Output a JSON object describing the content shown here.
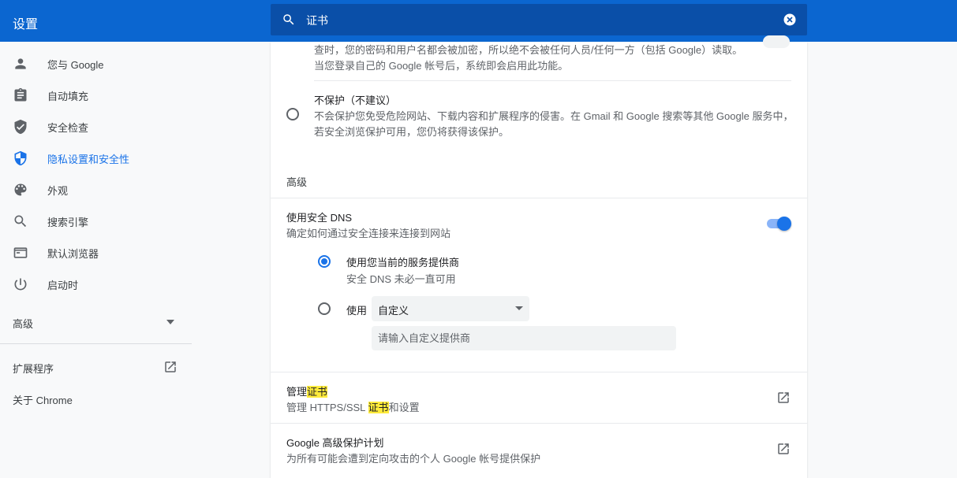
{
  "header": {
    "title": "设置",
    "search_value": "证书"
  },
  "sidebar": {
    "items": [
      {
        "label": "您与 Google",
        "icon": "person-icon"
      },
      {
        "label": "自动填充",
        "icon": "clipboard-icon"
      },
      {
        "label": "安全检查",
        "icon": "shield-check-icon"
      },
      {
        "label": "隐私设置和安全性",
        "icon": "shield-privacy-icon",
        "active": true
      },
      {
        "label": "外观",
        "icon": "palette-icon"
      },
      {
        "label": "搜索引擎",
        "icon": "search-icon"
      },
      {
        "label": "默认浏览器",
        "icon": "browser-icon"
      },
      {
        "label": "启动时",
        "icon": "power-icon"
      }
    ],
    "advanced": "高级",
    "extensions": "扩展程序",
    "about": "关于 Chrome"
  },
  "main": {
    "top_text_line1": "查时，您的密码和用户名都会被加密，所以绝不会被任何人员/任何一方（包括 Google）读取。",
    "top_text_line2": "当您登录自己的 Google 帐号后，系统即会启用此功能。",
    "no_protection": {
      "title": "不保护（不建议）",
      "desc_line1": "不会保护您免受危险网站、下载内容和扩展程序的侵害。在 Gmail 和 Google 搜索等其他 Google 服务中，",
      "desc_line2": "若安全浏览保护可用，您仍将获得该保护。"
    },
    "advanced_heading": "高级",
    "secure_dns": {
      "title": "使用安全 DNS",
      "desc": "确定如何通过安全连接来连接到网站",
      "enabled": true,
      "option_current": "使用您当前的服务提供商",
      "option_current_desc": "安全 DNS 未必一直可用",
      "option_custom_prefix": "使用",
      "custom_select_value": "自定义",
      "custom_input_placeholder": "请输入自定义提供商"
    },
    "manage_certs": {
      "title_prefix": "管理",
      "title_highlight": "证书",
      "desc_prefix": "管理 HTTPS/SSL ",
      "desc_highlight": "证书",
      "desc_suffix": "和设置"
    },
    "advanced_protection": {
      "title": "Google 高级保护计划",
      "desc": "为所有可能会遭到定向攻击的个人 Google 帐号提供保护"
    }
  },
  "colors": {
    "header_bg": "#0b66d0",
    "accent": "#1a73e8",
    "highlight": "#ffeb3b"
  }
}
